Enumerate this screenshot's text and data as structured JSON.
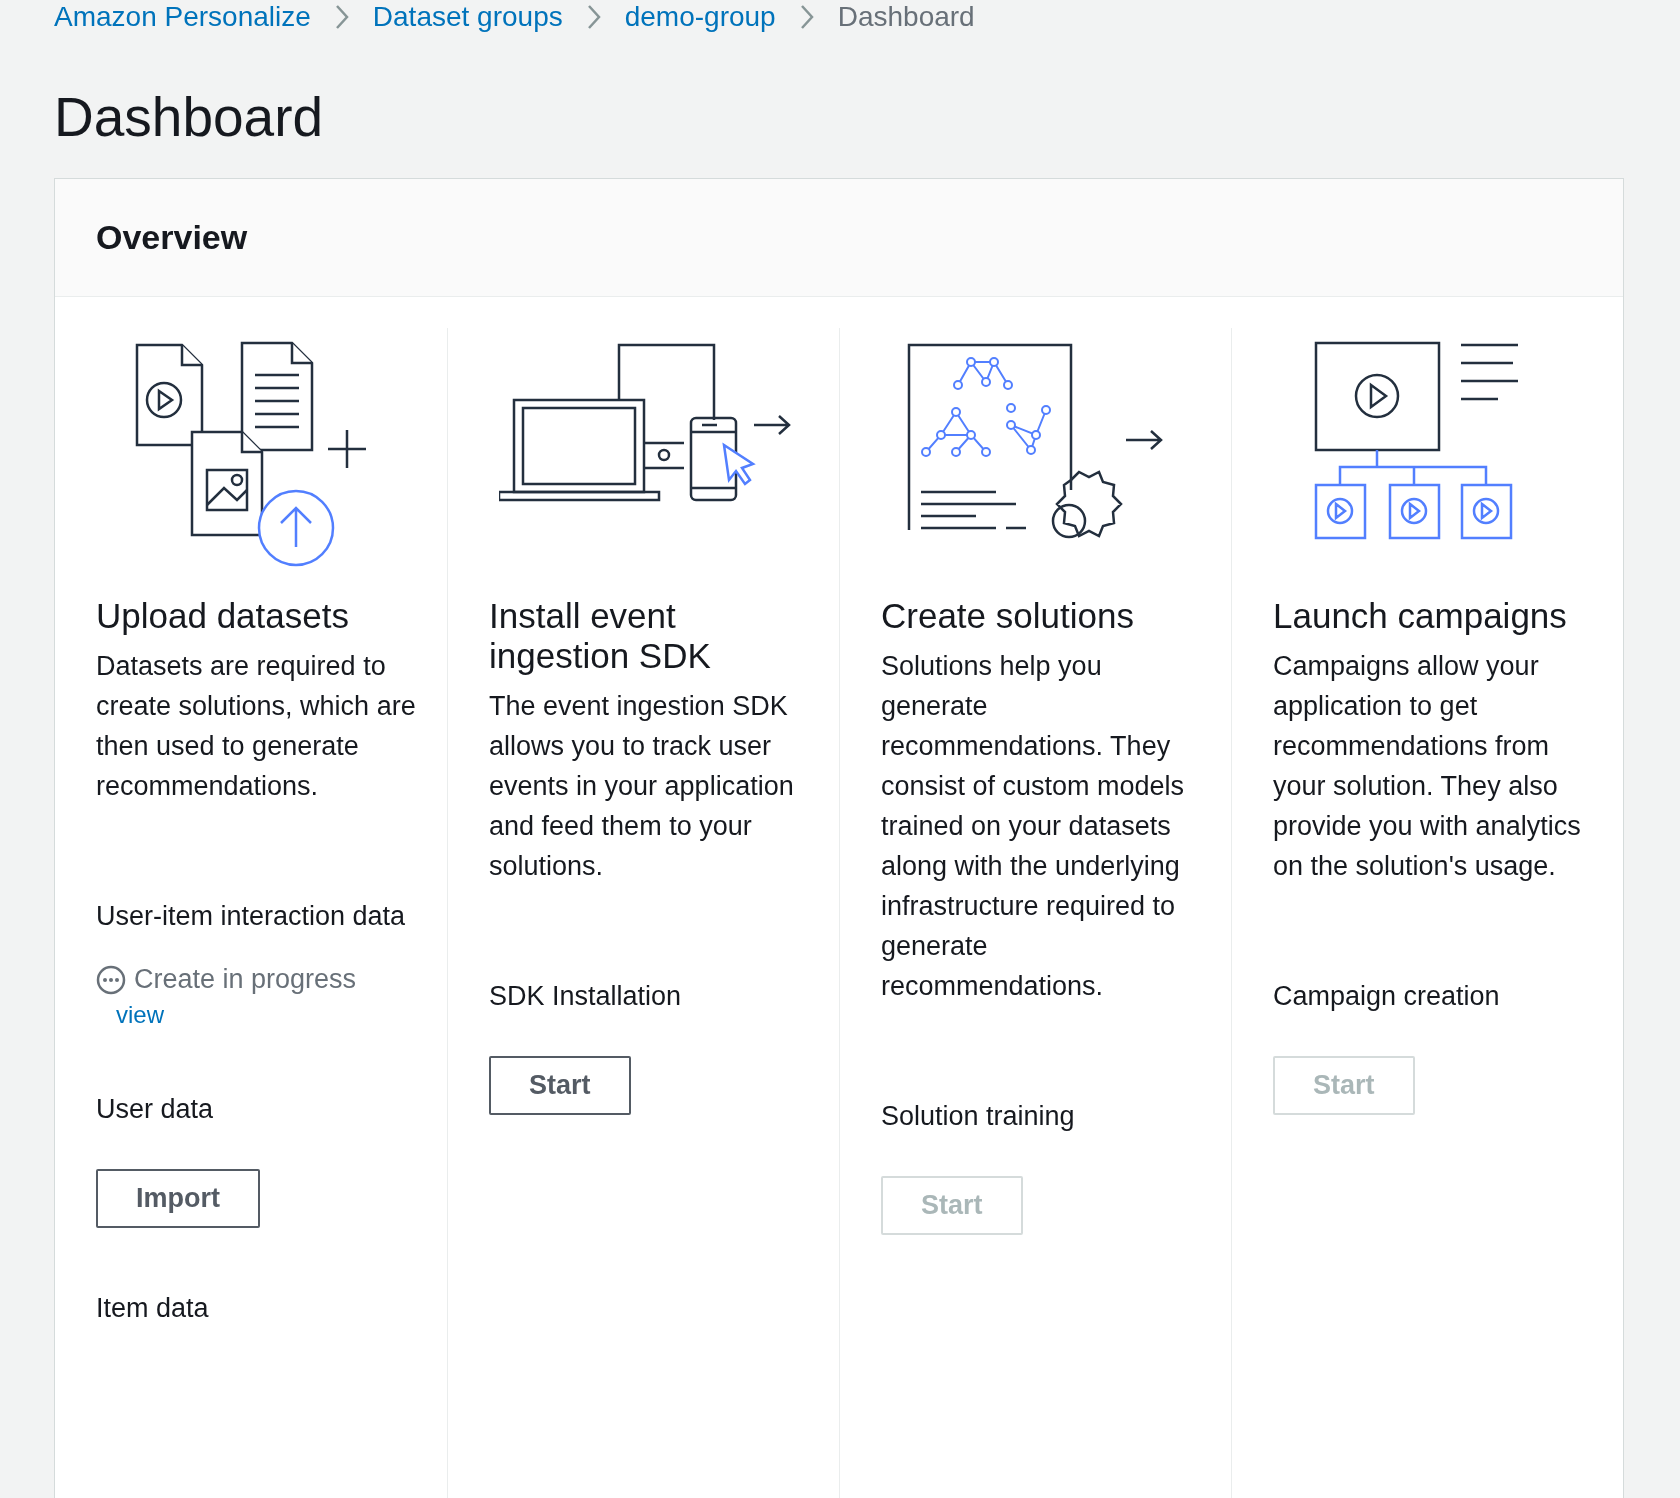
{
  "breadcrumbs": [
    {
      "label": "Amazon Personalize",
      "kind": "link"
    },
    {
      "label": "Dataset groups",
      "kind": "link"
    },
    {
      "label": "demo-group",
      "kind": "link"
    },
    {
      "label": "Dashboard",
      "kind": "current"
    }
  ],
  "title": "Dashboard",
  "panel": {
    "title": "Overview",
    "columns": [
      {
        "title": "Upload datasets",
        "description": "Datasets are required to create solutions, which are then used to generate recommendations.",
        "steps": [
          {
            "label": "User-item interaction data",
            "status": "Create in progress",
            "link": "view"
          },
          {
            "label": "User data",
            "button": {
              "label": "Import",
              "disabled": false
            }
          },
          {
            "label": "Item data"
          }
        ]
      },
      {
        "title": "Install event ingestion SDK",
        "description": "The event ingestion SDK allows you to track user events in your application and feed them to your solutions.",
        "steps": [
          {
            "label": "SDK Installation",
            "button": {
              "label": "Start",
              "disabled": false
            }
          }
        ]
      },
      {
        "title": "Create solutions",
        "description": "Solutions help you generate recommendations. They consist of custom models trained on your datasets along with the underlying infrastructure required to generate recommendations.",
        "steps": [
          {
            "label": "Solution training",
            "button": {
              "label": "Start",
              "disabled": true
            }
          }
        ]
      },
      {
        "title": "Launch campaigns",
        "description": "Campaigns allow your application to get recommendations from your solution. They also provide you with analytics on the solution's usage.",
        "steps": [
          {
            "label": "Campaign creation",
            "button": {
              "label": "Start",
              "disabled": true
            }
          }
        ]
      }
    ]
  }
}
